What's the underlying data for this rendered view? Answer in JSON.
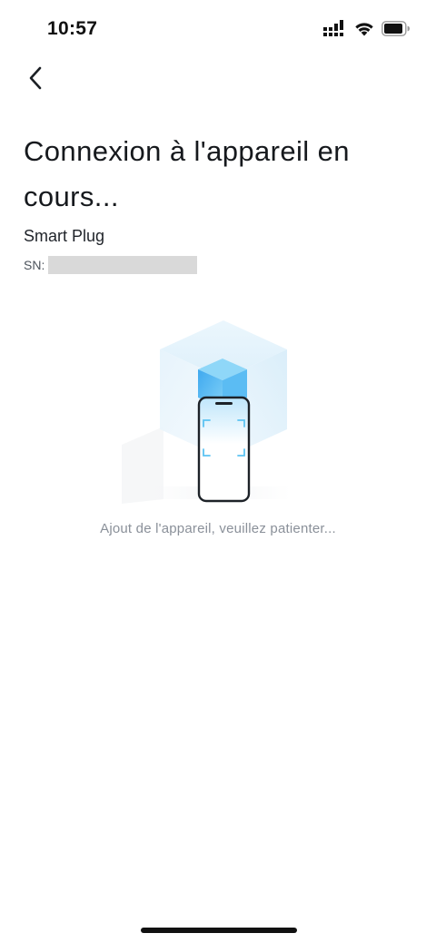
{
  "status_bar": {
    "time": "10:57"
  },
  "header": {
    "back_icon": "chevron-left-icon"
  },
  "title": "Connexion à l'appareil en cours...",
  "device": {
    "name": "Smart Plug",
    "serial_label": "SN:",
    "serial_value": ""
  },
  "illustration": {
    "icon": "phone-scan-cube-icon",
    "accent_color": "#5cc3f2",
    "cube_color": "#d7edf9"
  },
  "status_message": "Ajout de l'appareil, veuillez patienter..."
}
